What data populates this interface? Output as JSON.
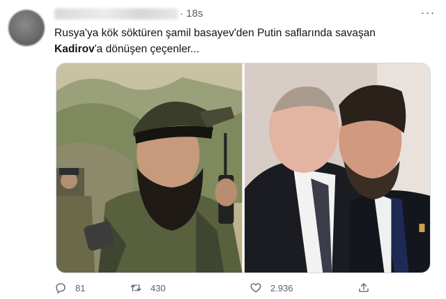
{
  "tweet": {
    "time": "18s",
    "more_icon": "more-horizontal-icon",
    "text_line1": "Rusya'ya kök söktüren şamil basayev'den Putin saflarında savaşan",
    "text_bold": "Kadirov",
    "text_line2_rest": "'a dönüşen çeçenler..."
  },
  "actions": {
    "reply_count": "81",
    "retweet_count": "430",
    "like_count": "2.936"
  },
  "icons": [
    "reply-icon",
    "retweet-icon",
    "like-icon",
    "share-icon"
  ]
}
